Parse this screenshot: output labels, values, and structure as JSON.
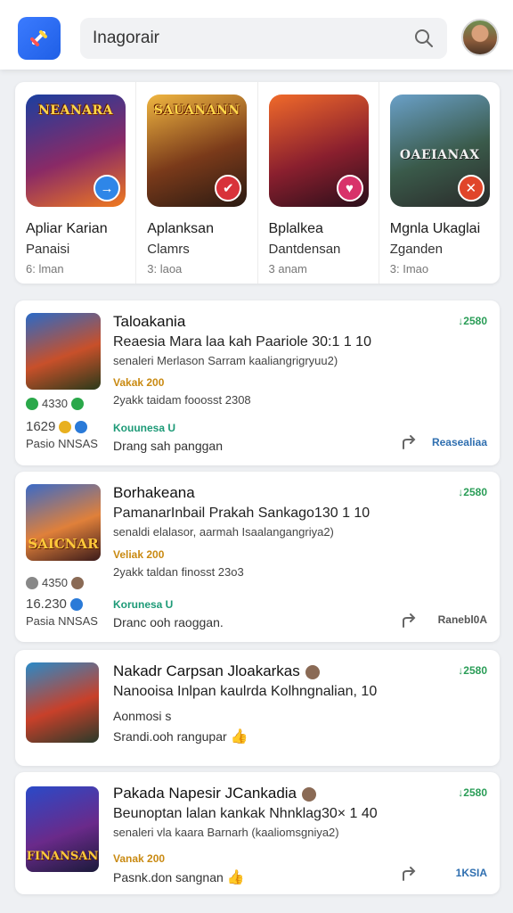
{
  "search": {
    "value": "Inagorair"
  },
  "featured": [
    {
      "art_title": "NEANARA",
      "name": "Apliar Karian",
      "sub": "Panaisi",
      "meta": "6: lman",
      "badge": "→",
      "colors": [
        "#1a3fa0",
        "#8a2a66",
        "#f07a1f"
      ],
      "badge_color": "#2e86e8"
    },
    {
      "art_title": "SAUANANN",
      "name": "Aplanksan",
      "sub": "Clamrs",
      "meta": "3: laoa",
      "badge": "✔",
      "colors": [
        "#f0b640",
        "#7a3a1a",
        "#2a1a12"
      ],
      "badge_color": "#d8323a"
    },
    {
      "art_title": "",
      "name": "Bplalkea",
      "sub": "Dantdensan",
      "meta": "3 anam",
      "badge": "♥",
      "colors": [
        "#f06a2a",
        "#8a1f2e",
        "#2a0f1a"
      ],
      "badge_color": "#d8326a"
    },
    {
      "art_title": "OAEIANAX",
      "name": "Mgnla Ukaglai",
      "sub": "Zganden",
      "meta": "3: Imao",
      "badge": "✕",
      "colors": [
        "#6aa0c8",
        "#3a5a4a",
        "#2a2a2a"
      ],
      "badge_color": "#e0452a"
    }
  ],
  "items": [
    {
      "thumb_label": "",
      "thumb_colors": [
        "#2a6ac8",
        "#c8502a",
        "#2a3a1a"
      ],
      "title": "Taloakania",
      "price": "↓2580",
      "desc": "Reaesia Mara laa kah Paariole 30:1 1 10",
      "desc2": "senaleri Merlason Sarram kaaliangrigryuu2)",
      "tag": "Vakak 200",
      "date": "2yakk taidam fooosst 2308",
      "link": "Kouunesa U",
      "detail": "Drang sah panggan",
      "stat1": "4330",
      "stat2": "1629",
      "stat3": "Pasio NNSAS",
      "action": "Reasealiaa"
    },
    {
      "thumb_label": "SAICNAR",
      "thumb_colors": [
        "#3a6ac8",
        "#e0803a",
        "#3a1a1a"
      ],
      "title": "Borhakeana",
      "price": "↓2580",
      "desc": "PamanarInbail Prakah Sankago130 1 10",
      "desc2": "senaldi elalasor, aarmah Isaalangangriya2)",
      "tag": "Veliak 200",
      "date": "2yakk taldan finosst 23o3",
      "link": "Korunesa U",
      "detail": "Dranc ooh raoggan.",
      "stat1": "4350",
      "stat2": "16.230",
      "stat3": "Pasia NNSAS",
      "action": "Ranebl0A"
    },
    {
      "thumb_label": "",
      "thumb_colors": [
        "#2a8ac8",
        "#c8402a",
        "#2a3a2a"
      ],
      "title": "Nakadr Carpsan Jloakarkas",
      "price": "↓2580",
      "desc": "Nanooisa Inlpan kaulrda Kolhngnalian, 10",
      "desc2": "",
      "tag": "",
      "date": "",
      "link": "",
      "detail": "Aonmosi s",
      "detail2": "Srandi.ooh rangupar",
      "stat1": "",
      "stat2": "",
      "stat3": "",
      "action": ""
    },
    {
      "thumb_label": "FINANSAN",
      "thumb_colors": [
        "#2a4ac8",
        "#6a2a8a",
        "#1a1a3a"
      ],
      "title": "Pakada Napesir JCankadia",
      "price": "↓2580",
      "desc": "Beunoptan lalan kankak Nhnklag30× 1 40",
      "desc2": "senaleri vla kaara Barnarh (kaaliomsgniya2)",
      "tag": "Vanak 200",
      "date": "",
      "link": "",
      "detail": "Pasnk.don sangnan",
      "stat1": "",
      "stat2": "",
      "stat3": "",
      "action": "1KSIA"
    }
  ]
}
